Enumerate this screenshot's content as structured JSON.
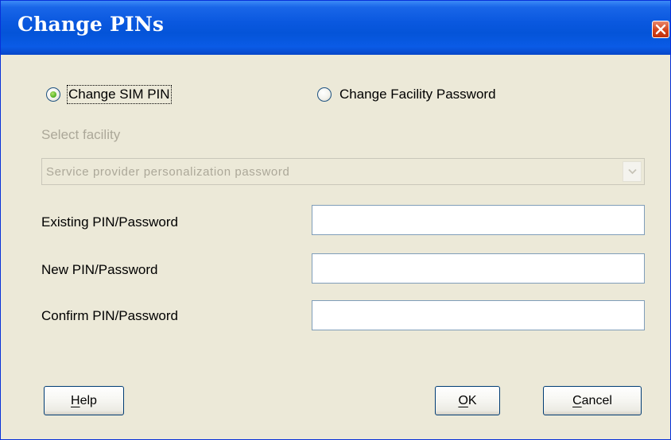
{
  "window": {
    "title": "Change PINs",
    "close_label": "Close"
  },
  "radios": {
    "sim_pin": {
      "label": "Change SIM PIN",
      "checked": true
    },
    "facility_password": {
      "label": "Change Facility Password",
      "checked": false
    }
  },
  "facility": {
    "label": "Select facility",
    "selected_value": "Service provider personalization password",
    "enabled": false
  },
  "fields": {
    "existing": {
      "label": "Existing PIN/Password",
      "value": ""
    },
    "new": {
      "label": "New PIN/Password",
      "value": ""
    },
    "confirm": {
      "label": "Confirm PIN/Password",
      "value": ""
    }
  },
  "buttons": {
    "help": {
      "mnemonic": "H",
      "rest": "elp"
    },
    "ok": {
      "mnemonic": "O",
      "rest": "K"
    },
    "cancel": {
      "mnemonic": "C",
      "rest": "ancel"
    }
  },
  "colors": {
    "titlebar": "#0454d8",
    "dialog_background": "#ece9d8",
    "disabled_text": "#aca899",
    "input_border": "#7f9db9",
    "radio_check": "#5cb82a",
    "close_button": "#d4431b"
  },
  "icons": {
    "close": "close-x-icon",
    "combo_arrow": "chevron-down-icon"
  }
}
